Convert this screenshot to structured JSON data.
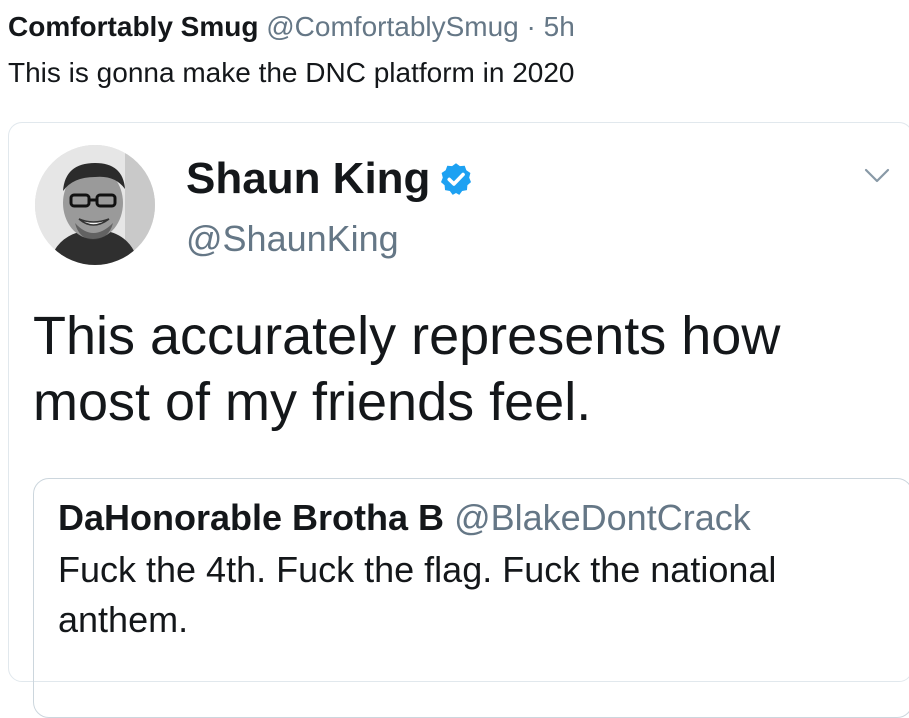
{
  "outer_tweet": {
    "author_name": "Comfortably Smug",
    "author_handle": "@ComfortablySmug",
    "separator": "·",
    "timestamp": "5h",
    "text": "This is gonna make the DNC platform in 2020"
  },
  "quoted_tweet": {
    "author_name": "Shaun King",
    "author_handle": "@ShaunKing",
    "verified": true,
    "verified_color": "#1da1f2",
    "avatar_icon": "profile-photo",
    "menu_icon": "chevron-down-icon",
    "text": "This accurately represents how most of my friends feel."
  },
  "nested_quote": {
    "author_name": "DaHonorable Brotha B",
    "author_handle": "@BlakeDontCrack",
    "text": "Fuck the 4th. Fuck the flag. Fuck the national anthem."
  },
  "colors": {
    "text_primary": "#14171a",
    "text_secondary": "#657786",
    "border": "#e1e8ed"
  }
}
